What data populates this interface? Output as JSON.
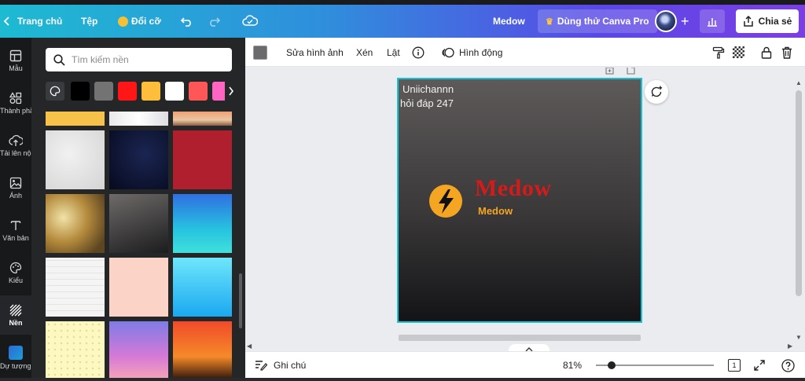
{
  "topbar": {
    "home": "Trang chủ",
    "file": "Tệp",
    "resize": "Đổi cỡ",
    "doc_title": "Medow",
    "try_pro": "Dùng thử Canva Pro",
    "share": "Chia sẻ"
  },
  "rail": [
    {
      "label": "Mẫu",
      "icon": "template-icon"
    },
    {
      "label": "Thành phần",
      "icon": "elements-icon"
    },
    {
      "label": "Tải lên nội dung t...",
      "icon": "upload-icon"
    },
    {
      "label": "Ảnh",
      "icon": "photo-icon"
    },
    {
      "label": "Văn bản",
      "icon": "text-icon"
    },
    {
      "label": "Kiểu",
      "icon": "palette-icon"
    },
    {
      "label": "Nền",
      "icon": "background-icon"
    },
    {
      "label": "Dự tượng...",
      "icon": "app-icon"
    }
  ],
  "panel": {
    "search_placeholder": "Tìm kiếm nền",
    "swatch_colors": [
      "#000000",
      "#737373",
      "#ff1616",
      "#ffbd3c",
      "#ffffff",
      "#ff5757",
      "#ff66c4"
    ]
  },
  "toolbar": {
    "edit_image": "Sửa hình ảnh",
    "crop": "Xén",
    "flip": "Lật",
    "animate": "Hình động"
  },
  "page": {
    "line1": "Uniichannn",
    "line2": "hỏi đáp 247",
    "brand_title": "Medow",
    "brand_sub": "Medow"
  },
  "bottombar": {
    "notes": "Ghi chú",
    "zoom": "81%",
    "page_count": "1"
  },
  "colors": {
    "page_outline": "#14c3d7",
    "brand_title": "#d51a1a",
    "brand_accent": "#f4a623"
  }
}
